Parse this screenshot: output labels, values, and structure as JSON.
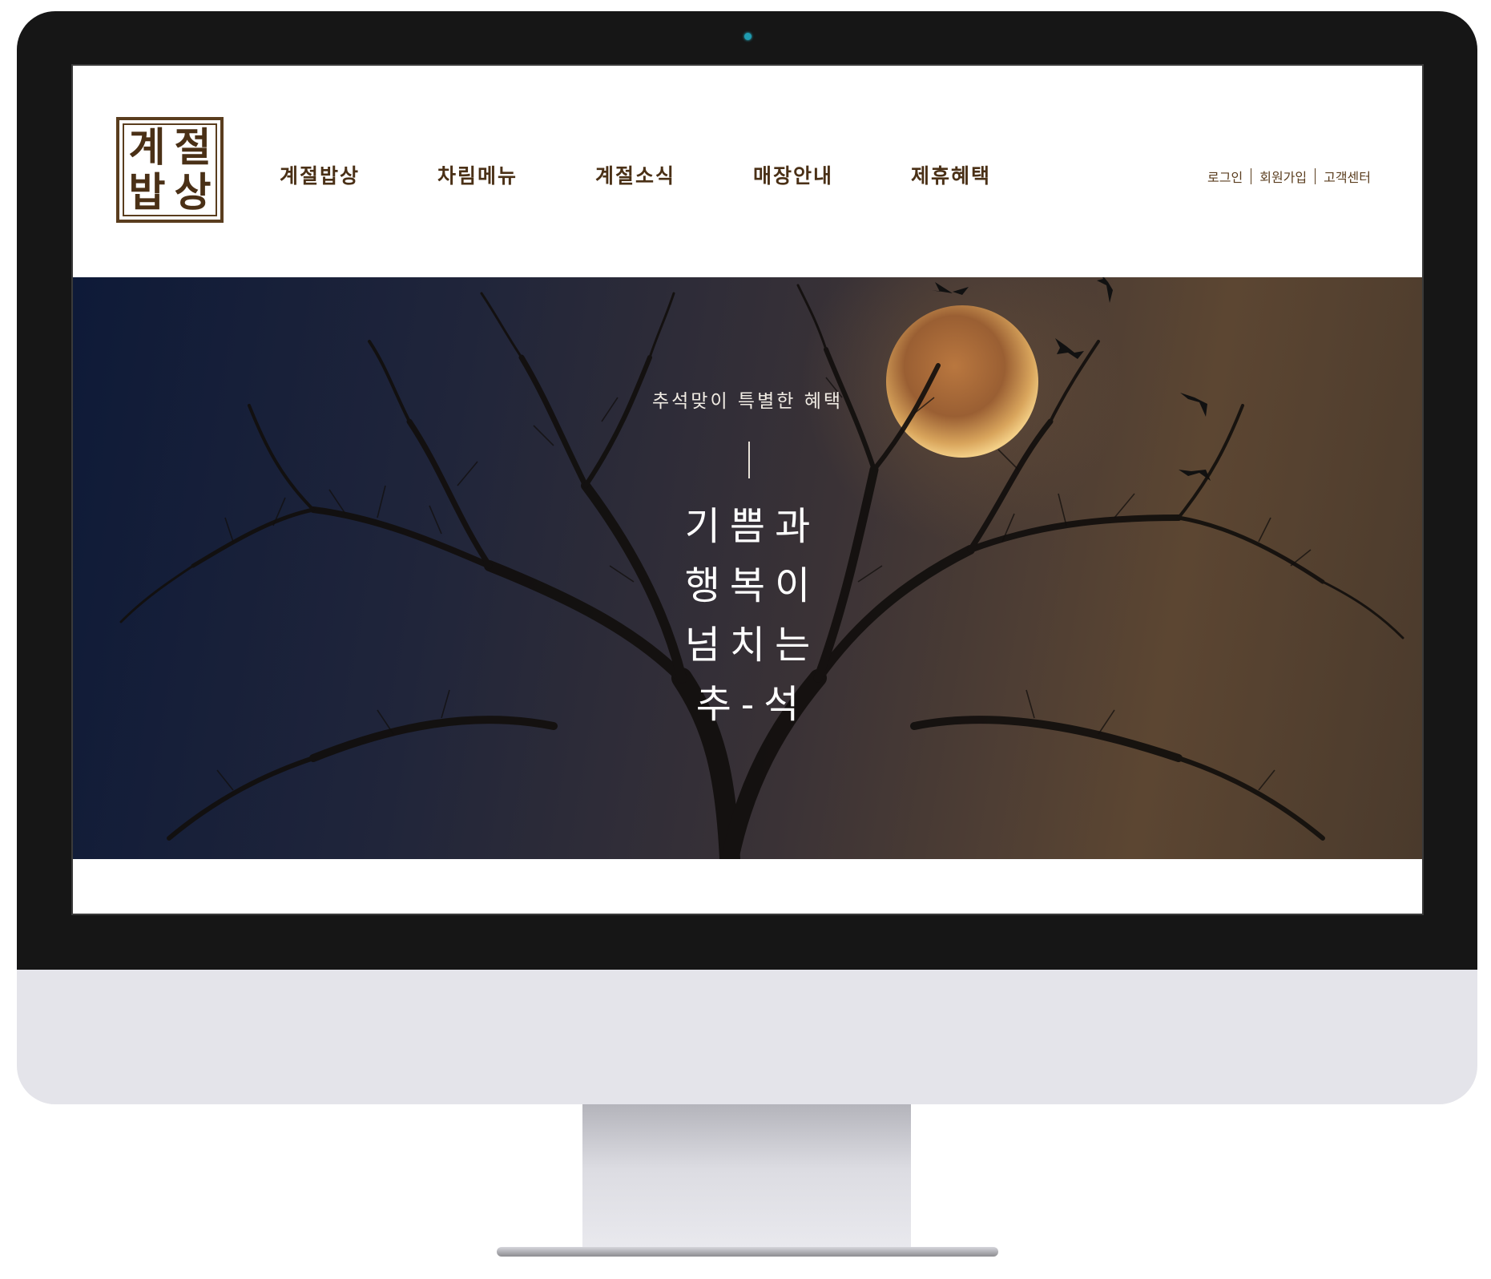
{
  "brand": {
    "logo_chars": [
      "계",
      "절",
      "밥",
      "상"
    ]
  },
  "nav": {
    "items": [
      "계절밥상",
      "차림메뉴",
      "계절소식",
      "매장안내",
      "제휴혜택"
    ]
  },
  "util": {
    "login": "로그인",
    "signup": "회원가입",
    "support": "고객센터"
  },
  "hero": {
    "subtitle": "추석맞이 특별한 혜택",
    "title_lines": [
      "기쁨과",
      "행복이",
      "넘치는",
      "추-석"
    ]
  },
  "colors": {
    "brand_brown": "#4a3016",
    "bezel": "#161616",
    "chassis": "#e4e4ea",
    "moon": "#c8874a"
  }
}
